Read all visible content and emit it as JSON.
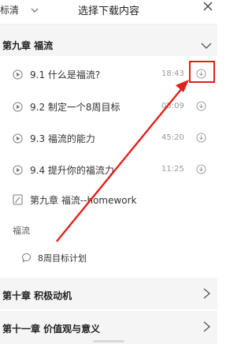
{
  "header": {
    "quality_label": "标清",
    "title": "选择下载内容"
  },
  "chapter9": {
    "title": "第九章 福流",
    "lessons": [
      {
        "title": "9.1 什么是福流?",
        "time": "18:43"
      },
      {
        "title": "9.2 制定一个8周目标",
        "time": "05:09"
      },
      {
        "title": "9.3 福流的能力",
        "time": "45:20"
      },
      {
        "title": "9.4 提升你的福流力",
        "time": "11:25"
      }
    ],
    "homework_label": "第九章 福流--homework",
    "section_label": "福流",
    "plan_label": "8周目标计划"
  },
  "chapters": [
    {
      "title": "第十章 积极动机"
    },
    {
      "title": "第十一章 价值观与意义"
    }
  ],
  "colors": {
    "annotation_red": "#e3201b",
    "icon_gray": "#999999"
  }
}
